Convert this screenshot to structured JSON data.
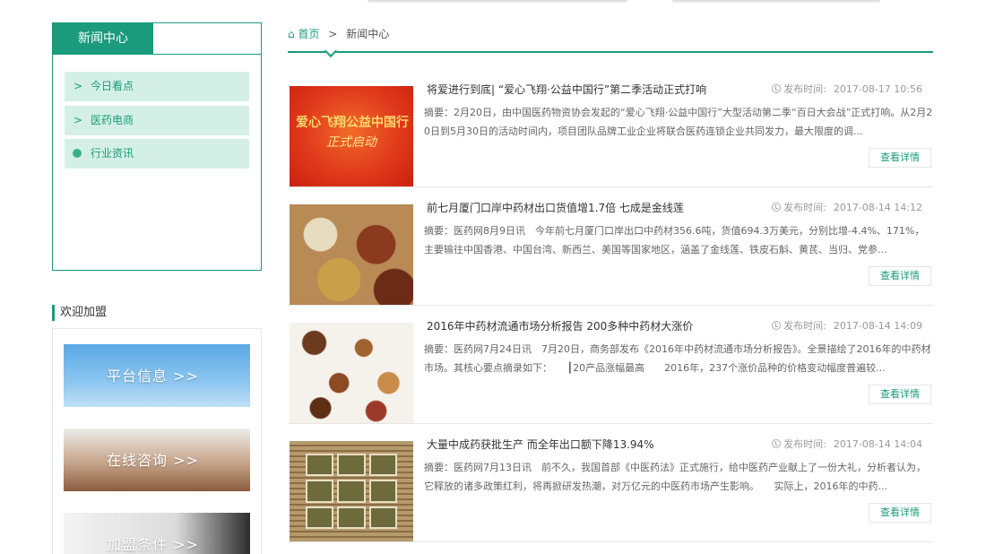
{
  "sidebar": {
    "title": "新闻中心",
    "items": [
      {
        "label": "今日看点",
        "icon": "chevron-right-icon"
      },
      {
        "label": "医药电商",
        "icon": "chevron-right-icon"
      },
      {
        "label": "行业资讯",
        "icon": "dot-icon"
      }
    ]
  },
  "join": {
    "title": "欢迎加盟",
    "banners": [
      {
        "label": "平台信息 >>"
      },
      {
        "label": "在线咨询 >>"
      },
      {
        "label": "加盟条件 >>"
      }
    ]
  },
  "breadcrumb": {
    "home": "首页",
    "separator": ">",
    "current": "新闻中心"
  },
  "thumb1": {
    "line1": "爱心飞翔公益中国行",
    "line2": "正式启动"
  },
  "news": {
    "time_label": "发布时间:",
    "detail_label": "查看详情",
    "summary_prefix": "摘要：",
    "items": [
      {
        "title": "将爱进行到底| “爱心飞翔·公益中国行”第二季活动正式打响",
        "time": "2017-08-17 10:56",
        "summary": "2月20日，由中国医药物资协会发起的“爱心飞翔·公益中国行”大型活动第二季“百日大会战”正式打响。从2月20日到5月30日的活动时间内，项目团队品牌工业企业将联合医药连锁企业共同发力，最大限度的调..."
      },
      {
        "title": "前七月厦门口岸中药材出口货值增1.7倍 七成是金线莲",
        "time": "2017-08-14 14:12",
        "summary": "医药网8月9日讯　今年前七月厦门口岸出口中药材356.6吨，货值694.3万美元，分别比增-4.4%、171%，主要输往中国香港、中国台湾、新西兰、美国等国家地区，涵盖了金线莲、铁皮石斛、黄芪、当归、党参..."
      },
      {
        "title": "2016年中药材流通市场分析报告 200多种中药材大涨价",
        "time": "2017-08-14 14:09",
        "summary": "医药网7月24日讯　7月20日，商务部发布《2016年中药材流通市场分析报告》。全景描绘了2016年的中药材市场。其核心要点摘录如下：　　┃20产品涨幅最高　　2016年，237个涨价品种的价格变动幅度普遍较..."
      },
      {
        "title": "大量中成药获批生产 而全年出口额下降13.94%",
        "time": "2017-08-14 14:04",
        "summary": "医药网7月13日讯　前不久，我国首部《中医药法》正式施行，给中医药产业献上了一份大礼，分析者认为，它释放的诸多政策红利，将再掀研发热潮，对万亿元的中医药市场产生影响。　　实际上，2016年的中药..."
      }
    ]
  },
  "colors": {
    "accent": "#1a9b7b",
    "item_bg": "#d4f0e6"
  }
}
